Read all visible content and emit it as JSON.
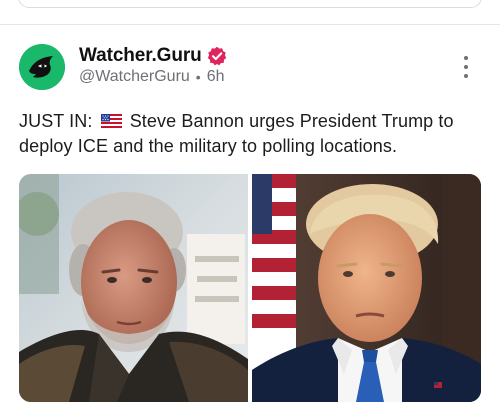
{
  "post": {
    "author": {
      "display_name": "Watcher.Guru",
      "handle": "@WatcherGuru",
      "time_ago": "6h",
      "separator": "•",
      "avatar_color": "#19b86b",
      "verified_color": "#e0245e",
      "verified_icon": "verified-badge-icon"
    },
    "text_prefix": "JUST IN:",
    "flag_icon": "us-flag-icon",
    "text_body": "Steve Bannon urges President Trump to deploy ICE and the military to polling locations.",
    "more_icon": "more-vertical-icon",
    "media": [
      {
        "name": "photo-steve-bannon",
        "alt": "Steve Bannon"
      },
      {
        "name": "photo-donald-trump",
        "alt": "Donald Trump"
      }
    ]
  }
}
